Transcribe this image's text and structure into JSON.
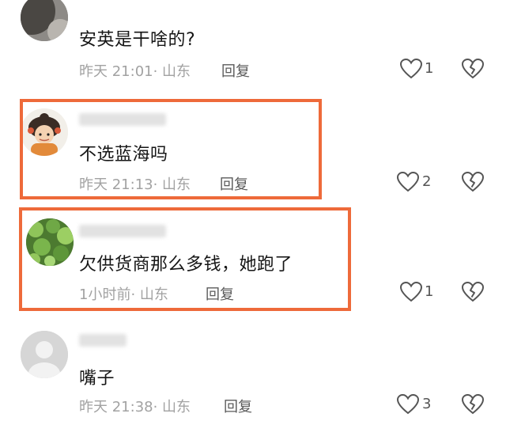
{
  "accent_color": "#ee6a3a",
  "comments": [
    {
      "text": "安英是干啥的?",
      "time": "昨天 21:01",
      "location": "· 山东",
      "reply_label": "回复",
      "like_count": "1",
      "avatar": "partial-dark-avatar"
    },
    {
      "text": "不选蓝海吗",
      "time": "昨天 21:13",
      "location": "· 山东",
      "reply_label": "回复",
      "like_count": "2",
      "avatar": "cartoon-girl-avatar"
    },
    {
      "text": "欠供货商那么多钱，她跑了",
      "time": "1小时前",
      "location": "· 山东",
      "reply_label": "回复",
      "like_count": "1",
      "avatar": "green-leaves-avatar"
    },
    {
      "text": "嘴子",
      "time": "昨天 21:38",
      "location": "· 山东",
      "reply_label": "回复",
      "like_count": "3",
      "avatar": "default-gray-avatar"
    }
  ],
  "icons": {
    "like": "heart-outline-icon",
    "dislike": "broken-heart-icon"
  }
}
